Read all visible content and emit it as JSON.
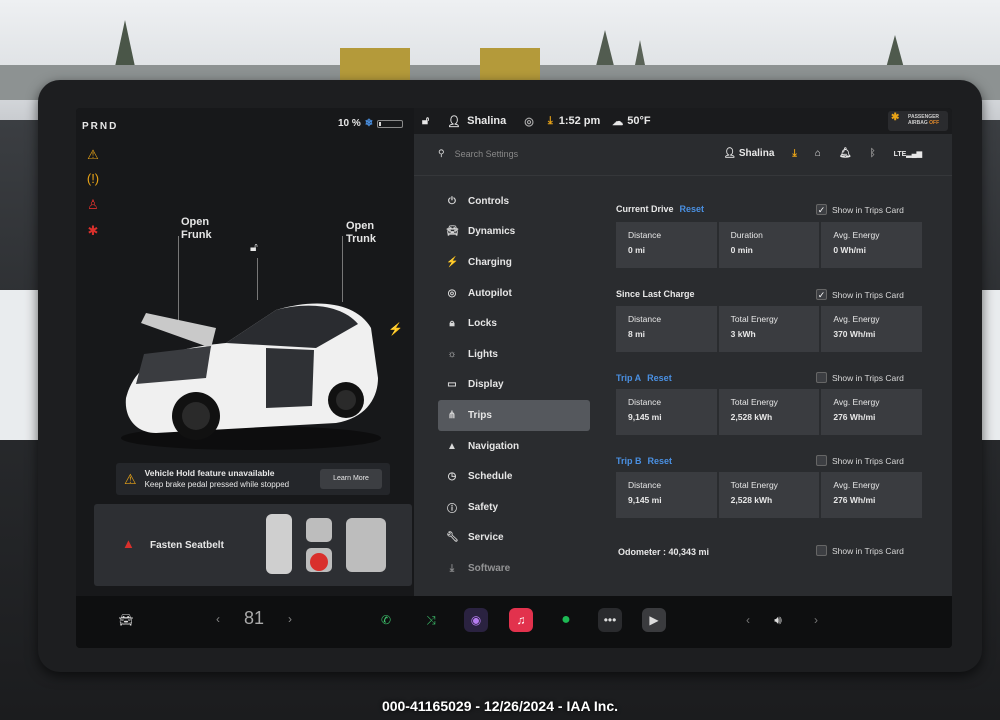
{
  "gear": "PRND",
  "battery": {
    "percent": "10 %",
    "level": 0.1
  },
  "car_panel": {
    "frunk_label": [
      "Open",
      "Frunk"
    ],
    "trunk_label": [
      "Open",
      "Trunk"
    ]
  },
  "alert": {
    "title": "Vehicle Hold feature unavailable",
    "subtitle": "Keep brake pedal pressed while stopped",
    "button": "Learn More"
  },
  "seatbelt_card": {
    "text": "Fasten Seatbelt"
  },
  "status_bar": {
    "user": "Shalina",
    "time": "1:52 pm",
    "temperature": "50°F",
    "airbag_line1": "PASSENGER",
    "airbag_line2": "AIRBAG",
    "airbag_state": "OFF"
  },
  "search": {
    "placeholder": "Search Settings"
  },
  "profile": {
    "name": "Shalina",
    "signal": "LTE"
  },
  "nav": [
    {
      "label": "Controls",
      "icon": "toggle-icon"
    },
    {
      "label": "Dynamics",
      "icon": "car-icon"
    },
    {
      "label": "Charging",
      "icon": "bolt-icon"
    },
    {
      "label": "Autopilot",
      "icon": "steering-wheel-icon"
    },
    {
      "label": "Locks",
      "icon": "lock-icon"
    },
    {
      "label": "Lights",
      "icon": "sun-icon"
    },
    {
      "label": "Display",
      "icon": "display-icon"
    },
    {
      "label": "Trips",
      "icon": "trips-icon"
    },
    {
      "label": "Navigation",
      "icon": "navigation-icon"
    },
    {
      "label": "Schedule",
      "icon": "clock-icon"
    },
    {
      "label": "Safety",
      "icon": "alert-circle-icon"
    },
    {
      "label": "Service",
      "icon": "wrench-icon"
    },
    {
      "label": "Software",
      "icon": "download-icon"
    }
  ],
  "sections": {
    "current_drive": {
      "title": "Current Drive",
      "reset": "Reset",
      "show": "Show in Trips Card",
      "checked": true,
      "stats": [
        {
          "k": "Distance",
          "v": "0 mi"
        },
        {
          "k": "Duration",
          "v": "0 min"
        },
        {
          "k": "Avg. Energy",
          "v": "0 Wh/mi"
        }
      ]
    },
    "since_charge": {
      "title": "Since Last Charge",
      "show": "Show in Trips Card",
      "checked": true,
      "stats": [
        {
          "k": "Distance",
          "v": "8 mi"
        },
        {
          "k": "Total Energy",
          "v": "3 kWh"
        },
        {
          "k": "Avg. Energy",
          "v": "370 Wh/mi"
        }
      ]
    },
    "trip_a": {
      "title": "Trip A",
      "reset": "Reset",
      "show": "Show in Trips Card",
      "checked": false,
      "stats": [
        {
          "k": "Distance",
          "v": "9,145 mi"
        },
        {
          "k": "Total Energy",
          "v": "2,528 kWh"
        },
        {
          "k": "Avg. Energy",
          "v": "276 Wh/mi"
        }
      ]
    },
    "trip_b": {
      "title": "Trip B",
      "reset": "Reset",
      "show": "Show in Trips Card",
      "checked": false,
      "stats": [
        {
          "k": "Distance",
          "v": "9,145 mi"
        },
        {
          "k": "Total Energy",
          "v": "2,528 kWh"
        },
        {
          "k": "Avg. Energy",
          "v": "276 Wh/mi"
        }
      ]
    },
    "odometer": {
      "label": "Odometer :",
      "value": "40,343 mi",
      "show": "Show in Trips Card"
    }
  },
  "dock": {
    "temperature": "81"
  },
  "caption": "000-41165029 - 12/26/2024 - IAA Inc.",
  "colors": {
    "accent": "#4a90e2",
    "warning": "#e8a317",
    "alert": "#d9302c",
    "phone": "#3ec46d",
    "spotify": "#1db954"
  }
}
